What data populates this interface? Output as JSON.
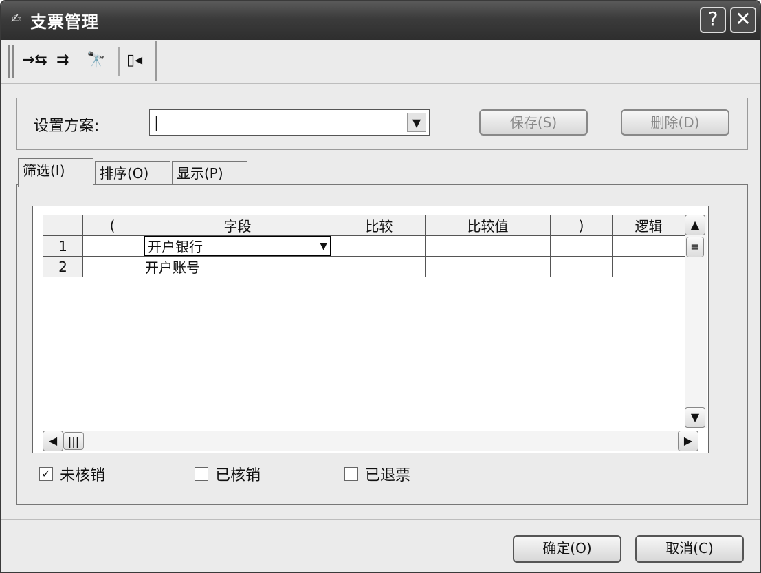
{
  "window": {
    "title": "支票管理",
    "help_label": "?",
    "close_label": "✕"
  },
  "toolbar": {
    "tools": [
      "→⇆",
      "⇉",
      "🔭",
      "▯◂"
    ]
  },
  "scheme": {
    "label": "设置方案:",
    "value": "|",
    "save_label": "保存(S)",
    "delete_label": "删除(D)"
  },
  "tabs": [
    {
      "label": "筛选(I)",
      "active": true
    },
    {
      "label": "排序(O)",
      "active": false
    },
    {
      "label": "显示(P)",
      "active": false
    }
  ],
  "grid": {
    "columns": [
      "",
      "(",
      "字段",
      "比较",
      "比较值",
      ")",
      "逻辑"
    ],
    "rows": [
      {
        "num": "1",
        "open": "",
        "field": "开户银行",
        "compare": "",
        "value": "",
        "close": "",
        "logic": ""
      },
      {
        "num": "2",
        "open": "",
        "field": "开户账号",
        "compare": "",
        "value": "",
        "close": "",
        "logic": ""
      }
    ]
  },
  "checkboxes": [
    {
      "label": "未核销",
      "checked": true
    },
    {
      "label": "已核销",
      "checked": false
    },
    {
      "label": "已退票",
      "checked": false
    }
  ],
  "footer": {
    "ok_label": "确定(O)",
    "cancel_label": "取消(C)"
  }
}
